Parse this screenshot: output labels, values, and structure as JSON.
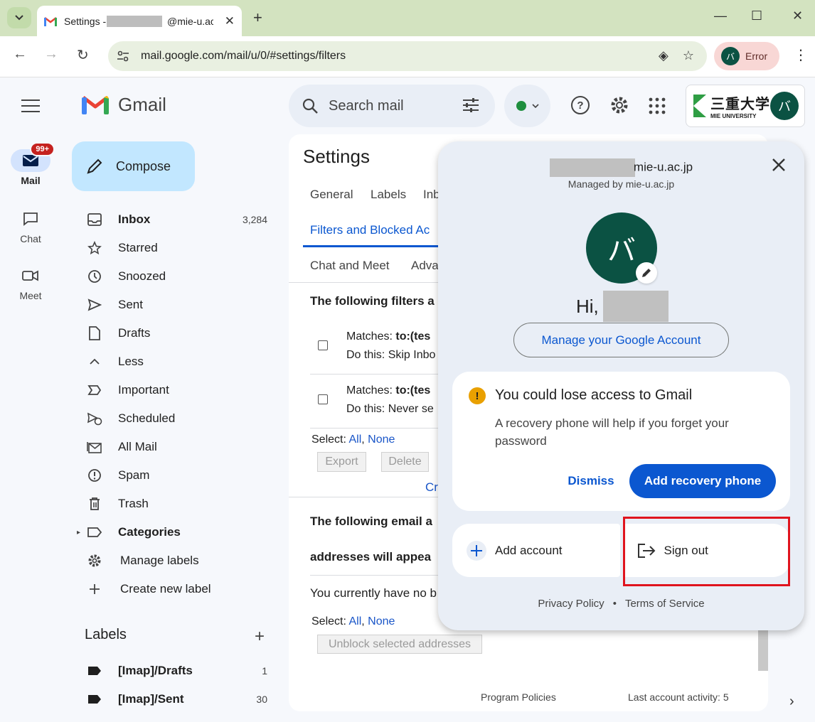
{
  "browser": {
    "tab_title_prefix": "Settings - ",
    "tab_title_suffix": "@mie-u.ac",
    "url": "mail.google.com/mail/u/0/#settings/filters",
    "profile_initial": "バ",
    "profile_status": "Error"
  },
  "rail": {
    "mail_label": "Mail",
    "mail_badge": "99+",
    "chat_label": "Chat",
    "meet_label": "Meet"
  },
  "header": {
    "logo_text": "Gmail",
    "search_placeholder": "Search mail",
    "org_name": "三重大学",
    "org_sub": "MIE UNIVERSITY",
    "avatar_initial": "バ"
  },
  "sidebar": {
    "compose_label": "Compose",
    "items": [
      {
        "label": "Inbox",
        "count": "3,284",
        "icon": "inbox-icon"
      },
      {
        "label": "Starred",
        "count": "",
        "icon": "star-icon"
      },
      {
        "label": "Snoozed",
        "count": "",
        "icon": "clock-icon"
      },
      {
        "label": "Sent",
        "count": "",
        "icon": "send-icon"
      },
      {
        "label": "Drafts",
        "count": "",
        "icon": "draft-icon"
      },
      {
        "label": "Less",
        "count": "",
        "icon": "chevron-up-icon"
      },
      {
        "label": "Important",
        "count": "",
        "icon": "important-icon"
      },
      {
        "label": "Scheduled",
        "count": "",
        "icon": "scheduled-icon"
      },
      {
        "label": "All Mail",
        "count": "",
        "icon": "all-mail-icon"
      },
      {
        "label": "Spam",
        "count": "",
        "icon": "spam-icon"
      },
      {
        "label": "Trash",
        "count": "",
        "icon": "trash-icon"
      },
      {
        "label": "Categories",
        "count": "",
        "icon": "label-icon"
      },
      {
        "label": "Manage labels",
        "count": "",
        "icon": "gear-icon"
      },
      {
        "label": "Create new label",
        "count": "",
        "icon": "plus-icon"
      }
    ],
    "labels_header": "Labels",
    "labels": [
      {
        "label": "[Imap]/Drafts",
        "count": "1"
      },
      {
        "label": "[Imap]/Sent",
        "count": "30"
      }
    ]
  },
  "settings": {
    "title": "Settings",
    "tabs": [
      "General",
      "Labels",
      "Inb",
      "Filters and Blocked Ac",
      "Chat and Meet",
      "Adva"
    ],
    "filters_heading": "The following filters a",
    "filter_rows": [
      {
        "matches_label": "Matches: ",
        "matches_value": "to:(tes",
        "action": "Do this: Skip Inbo"
      },
      {
        "matches_label": "Matches: ",
        "matches_value": "to:(tes",
        "action": "Do this: Never se"
      }
    ],
    "select_label": "Select: ",
    "select_all": "All",
    "select_sep": ", ",
    "select_none": "None",
    "export_label": "Export",
    "delete_label": "Delete",
    "create_link": "Cr",
    "blocked_heading_1": "The following email a",
    "blocked_heading_2": "addresses will appea",
    "blocked_empty": "You currently have no b",
    "unblock_label": "Unblock selected addresses",
    "footer_policies": "Program Policies",
    "footer_activity": "Last account activity: 5"
  },
  "popover": {
    "email_suffix": "mie-u.ac.jp",
    "managed_by": "Managed by mie-u.ac.jp",
    "avatar_initial": "バ",
    "greeting": "Hi,",
    "manage_account": "Manage your Google Account",
    "warning_title": "You could lose access to Gmail",
    "warning_body": "A recovery phone will help if you forget your password",
    "dismiss": "Dismiss",
    "add_recovery_phone": "Add recovery phone",
    "add_account": "Add account",
    "sign_out": "Sign out",
    "privacy_policy": "Privacy Policy",
    "separator": "•",
    "terms": "Terms of Service"
  },
  "colors": {
    "accent": "#0b57d0",
    "highlight": "#e0141e",
    "avatar": "#0b5243"
  }
}
